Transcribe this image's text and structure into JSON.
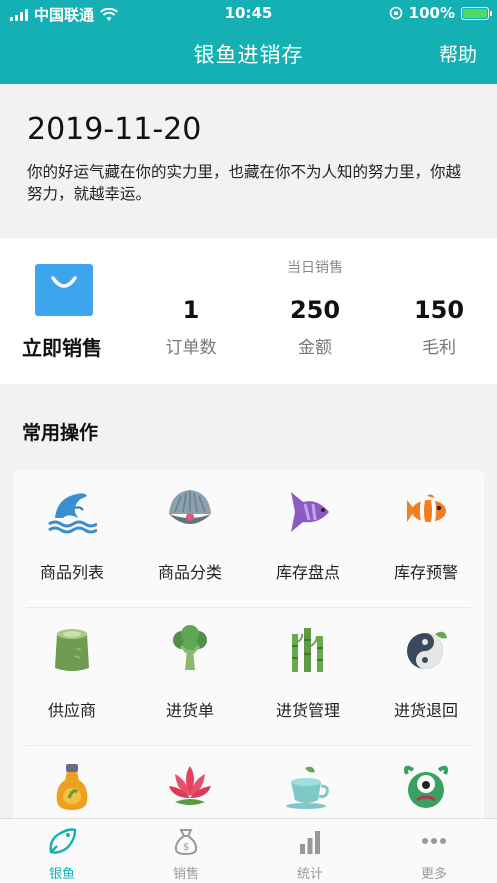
{
  "status_bar": {
    "carrier": "中国联通",
    "time": "10:45",
    "battery": "100%"
  },
  "header": {
    "title": "银鱼进销存",
    "help_label": "帮助"
  },
  "date_card": {
    "date": "2019-11-20",
    "motto": "你的好运气藏在你的实力里，也藏在你不为人知的努力里，你越努力，就越幸运。"
  },
  "sales": {
    "sell_now_label": "立即销售",
    "today_label": "当日销售",
    "stats": [
      {
        "value": "1",
        "label": "订单数"
      },
      {
        "value": "250",
        "label": "金额"
      },
      {
        "value": "150",
        "label": "毛利"
      }
    ]
  },
  "operations": {
    "title": "常用操作",
    "items": [
      {
        "label": "商品列表",
        "icon": "dolphin-icon"
      },
      {
        "label": "商品分类",
        "icon": "oyster-pearl-icon"
      },
      {
        "label": "库存盘点",
        "icon": "angelfish-icon"
      },
      {
        "label": "库存预警",
        "icon": "clownfish-icon"
      },
      {
        "label": "供应商",
        "icon": "bamboo-stump-icon"
      },
      {
        "label": "进货单",
        "icon": "broccoli-icon"
      },
      {
        "label": "进货管理",
        "icon": "bamboo-icon"
      },
      {
        "label": "进货退回",
        "icon": "yin-yang-icon"
      },
      {
        "label": "",
        "icon": "oil-bottle-icon"
      },
      {
        "label": "",
        "icon": "lotus-icon"
      },
      {
        "label": "",
        "icon": "tea-cup-icon"
      },
      {
        "label": "",
        "icon": "green-monster-icon"
      }
    ]
  },
  "tabbar": {
    "tabs": [
      {
        "label": "银鱼",
        "icon": "fish-icon",
        "active": true
      },
      {
        "label": "销售",
        "icon": "money-bag-icon",
        "active": false
      },
      {
        "label": "统计",
        "icon": "bar-chart-icon",
        "active": false
      },
      {
        "label": "更多",
        "icon": "more-dots-icon",
        "active": false
      }
    ]
  },
  "colors": {
    "brand": "#14b0b4",
    "bag_blue": "#3ca5ee",
    "tab_inactive": "#999999"
  }
}
